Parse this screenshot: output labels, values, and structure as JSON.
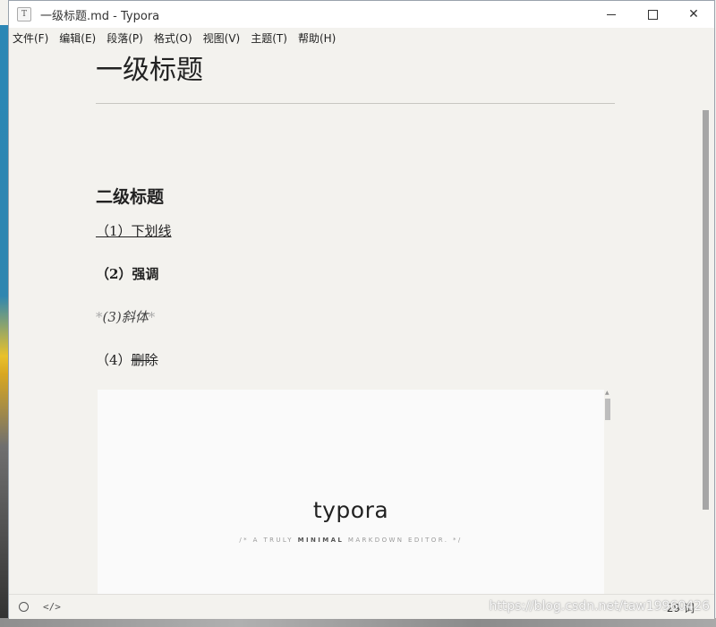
{
  "window": {
    "app_icon_letter": "T",
    "title": "一级标题.md - Typora",
    "minimize": "",
    "maximize": "",
    "close": "✕"
  },
  "menu": [
    "文件(F)",
    "编辑(E)",
    "段落(P)",
    "格式(O)",
    "视图(V)",
    "主题(T)",
    "帮助(H)"
  ],
  "document": {
    "h1": "一级标题",
    "h2": "二级标题",
    "underline_text": "（1）下划线",
    "bold_text": "（2）强调",
    "italic_marker": "*",
    "italic_text": "(3)斜体",
    "strike_prefix": "（4）",
    "strike_text": "删除"
  },
  "image": {
    "logo": "typora",
    "tagline_pre": "/* A TRULY ",
    "tagline_bold": "MINIMAL",
    "tagline_post": " MARKDOWN EDITOR. */",
    "scroll_arrow": "▲"
  },
  "statusbar": {
    "source_icon": "</>",
    "watermark": "https://blog.csdn.net/taw19960426",
    "word_count": "29 词"
  },
  "icons": {
    "app": "typora-icon",
    "outline": "circle-icon",
    "source": "code-icon"
  }
}
